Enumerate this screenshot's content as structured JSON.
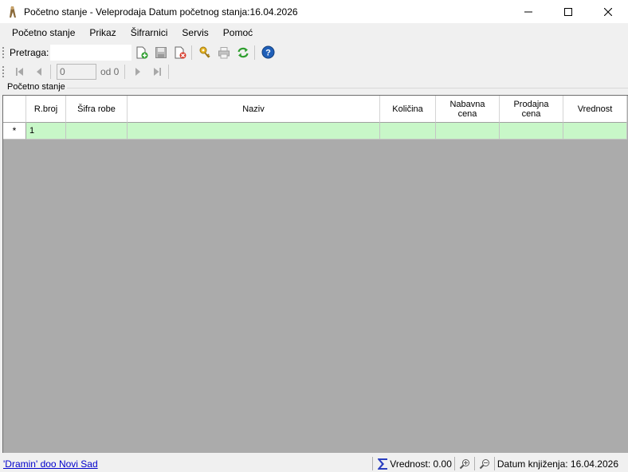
{
  "window": {
    "title": "Početno stanje - Veleprodaja Datum početnog stanja:16.04.2026"
  },
  "menu": [
    "Početno stanje",
    "Prikaz",
    "Šifrarnici",
    "Servis",
    "Pomoć"
  ],
  "toolbar": {
    "search_label": "Pretraga:",
    "search_value": ""
  },
  "navigator": {
    "position": "0",
    "of_label": "od 0"
  },
  "group_label": "Početno stanje",
  "grid": {
    "columns": [
      "R.broj",
      "Šifra robe",
      "Naziv",
      "Količina",
      "Nabavna\ncena",
      "Prodajna\ncena",
      "Vrednost"
    ],
    "new_row_marker": "*",
    "new_row_values": [
      "1",
      "",
      "",
      "",
      "",
      "",
      ""
    ]
  },
  "status": {
    "company": "'Dramin' doo Novi Sad",
    "total": "Vrednost: 0.00",
    "posting_date": "Datum knjiženja: 16.04.2026"
  },
  "colors": {
    "new_row_bg": "#c8f7c8",
    "grid_bg": "#ababab",
    "link": "#0000cc"
  },
  "icons": [
    "app-icon",
    "minimize-icon",
    "maximize-icon",
    "close-icon",
    "new-icon",
    "save-icon",
    "delete-icon",
    "key-icon",
    "print-icon",
    "refresh-icon",
    "help-icon",
    "first-icon",
    "prev-icon",
    "next-icon",
    "last-icon",
    "sigma-icon",
    "zoom-in-icon",
    "zoom-out-icon"
  ]
}
